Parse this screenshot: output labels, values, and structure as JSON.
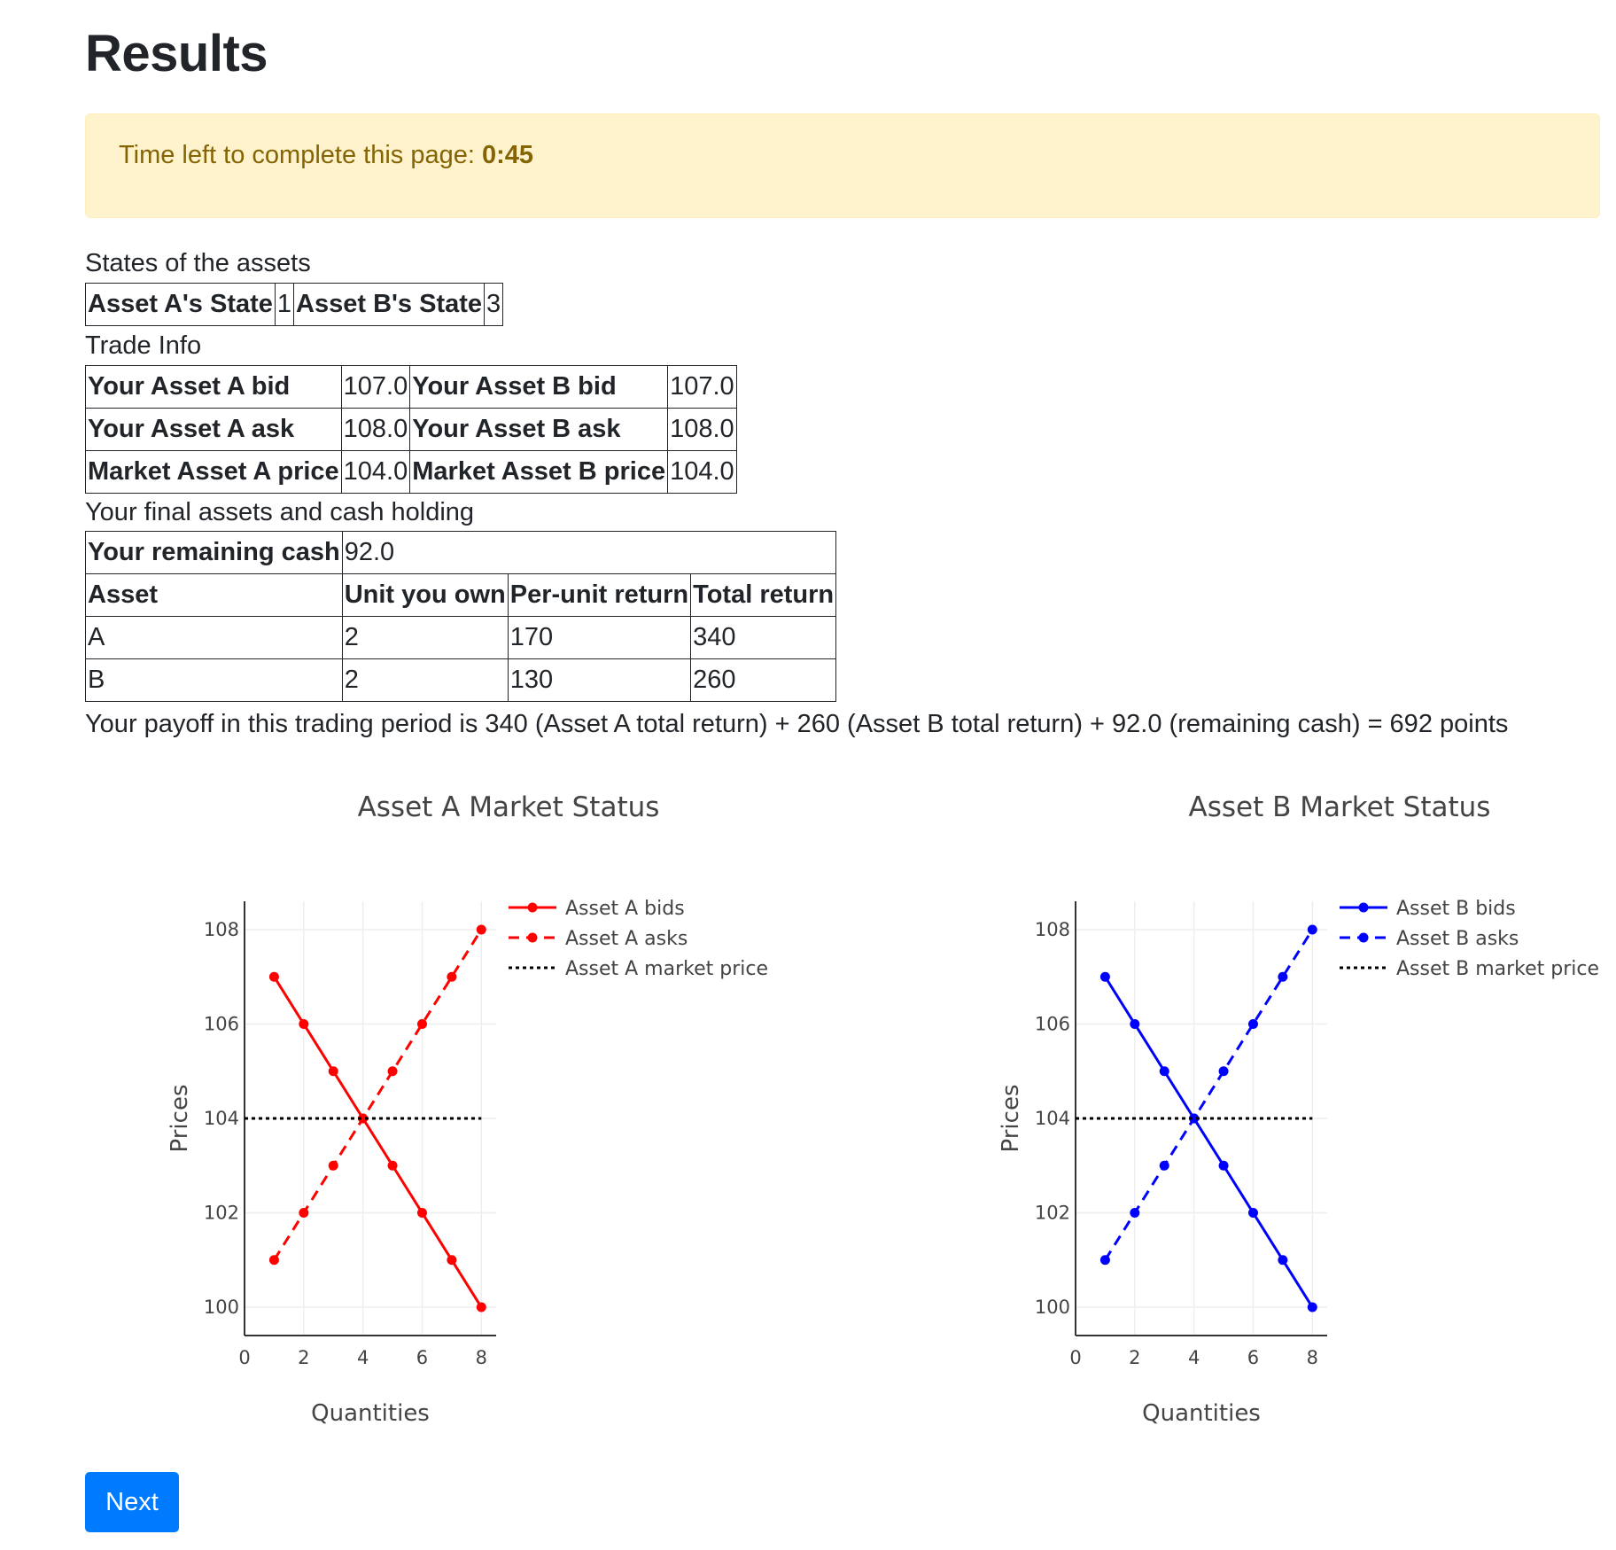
{
  "page": {
    "title": "Results",
    "timer_label": "Time left to complete this page:",
    "timer_value": "0:45"
  },
  "states": {
    "caption": "States of the assets",
    "a_label": "Asset A's State",
    "a_value": "1",
    "b_label": "Asset B's State",
    "b_value": "3"
  },
  "trade": {
    "caption": "Trade Info",
    "rows": [
      {
        "a_label": "Your Asset A bid",
        "a_value": "107.0",
        "b_label": "Your Asset B bid",
        "b_value": "107.0"
      },
      {
        "a_label": "Your Asset A ask",
        "a_value": "108.0",
        "b_label": "Your Asset B ask",
        "b_value": "108.0"
      },
      {
        "a_label": "Market Asset A price",
        "a_value": "104.0",
        "b_label": "Market Asset B price",
        "b_value": "104.0"
      }
    ]
  },
  "holdings": {
    "caption": "Your final assets and cash holding",
    "cash_label": "Your remaining cash",
    "cash_value": "92.0",
    "headers": [
      "Asset",
      "Unit you own",
      "Per-unit return",
      "Total return"
    ],
    "rows": [
      [
        "A",
        "2",
        "170",
        "340"
      ],
      [
        "B",
        "2",
        "130",
        "260"
      ]
    ]
  },
  "payoff_text": "Your payoff in this trading period is 340 (Asset A total return) + 260 (Asset B total return) + 92.0 (remaining cash) = 692 points",
  "next_label": "Next",
  "chart_data": [
    {
      "type": "line",
      "title": "Asset A Market Status",
      "xlabel": "Quantities",
      "ylabel": "Prices",
      "xlim": [
        0,
        8.5
      ],
      "ylim": [
        99.4,
        108.6
      ],
      "xticks": [
        0,
        2,
        4,
        6,
        8
      ],
      "yticks": [
        100,
        102,
        104,
        106,
        108
      ],
      "grid": true,
      "legend": "top-right",
      "color": "#ff0000",
      "series": [
        {
          "name": "Asset A bids",
          "style": "solid",
          "x": [
            1,
            2,
            3,
            4,
            5,
            6,
            7,
            8
          ],
          "y": [
            107,
            106,
            105,
            104,
            103,
            102,
            101,
            100
          ]
        },
        {
          "name": "Asset A asks",
          "style": "dash",
          "x": [
            1,
            2,
            3,
            4,
            5,
            6,
            7,
            8
          ],
          "y": [
            101,
            102,
            103,
            104,
            105,
            106,
            107,
            108
          ]
        },
        {
          "name": "Asset A market price",
          "style": "dot",
          "x": [
            0,
            8
          ],
          "y": [
            104,
            104
          ]
        }
      ]
    },
    {
      "type": "line",
      "title": "Asset B Market Status",
      "xlabel": "Quantities",
      "ylabel": "Prices",
      "xlim": [
        0,
        8.5
      ],
      "ylim": [
        99.4,
        108.6
      ],
      "xticks": [
        0,
        2,
        4,
        6,
        8
      ],
      "yticks": [
        100,
        102,
        104,
        106,
        108
      ],
      "grid": true,
      "legend": "top-right",
      "color": "#0000ff",
      "series": [
        {
          "name": "Asset B bids",
          "style": "solid",
          "x": [
            1,
            2,
            3,
            4,
            5,
            6,
            7,
            8
          ],
          "y": [
            107,
            106,
            105,
            104,
            103,
            102,
            101,
            100
          ]
        },
        {
          "name": "Asset B asks",
          "style": "dash",
          "x": [
            1,
            2,
            3,
            4,
            5,
            6,
            7,
            8
          ],
          "y": [
            101,
            102,
            103,
            104,
            105,
            106,
            107,
            108
          ]
        },
        {
          "name": "Asset B market price",
          "style": "dot",
          "x": [
            0,
            8
          ],
          "y": [
            104,
            104
          ]
        }
      ]
    }
  ]
}
